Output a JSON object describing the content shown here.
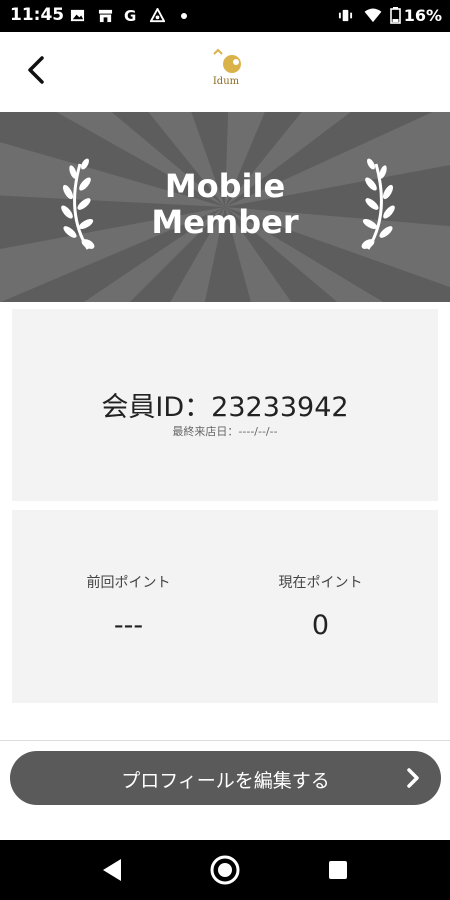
{
  "status_bar": {
    "time": "11:45",
    "battery_percent": "16%",
    "icons": [
      "image-icon",
      "store-icon",
      "google-icon",
      "triangle-app-icon",
      "dot-icon",
      "vibrate-icon",
      "wifi-icon",
      "battery-icon"
    ]
  },
  "header": {
    "back_icon": "chevron-left-icon",
    "logo_text": "Idum"
  },
  "banner": {
    "title_line1": "Mobile",
    "title_line2": "Member"
  },
  "member": {
    "id_text": "会員ID：23233942",
    "last_visit": "最終来店日：----/--/--"
  },
  "points": {
    "previous_label": "前回ポイント",
    "previous_value": "---",
    "current_label": "現在ポイント",
    "current_value": "0"
  },
  "edit_profile": {
    "label": "プロフィールを編集する"
  },
  "colors": {
    "banner_bg": "#5d5d5d",
    "card_bg": "#f3f3f3",
    "button_bg": "#5a5a5a"
  }
}
